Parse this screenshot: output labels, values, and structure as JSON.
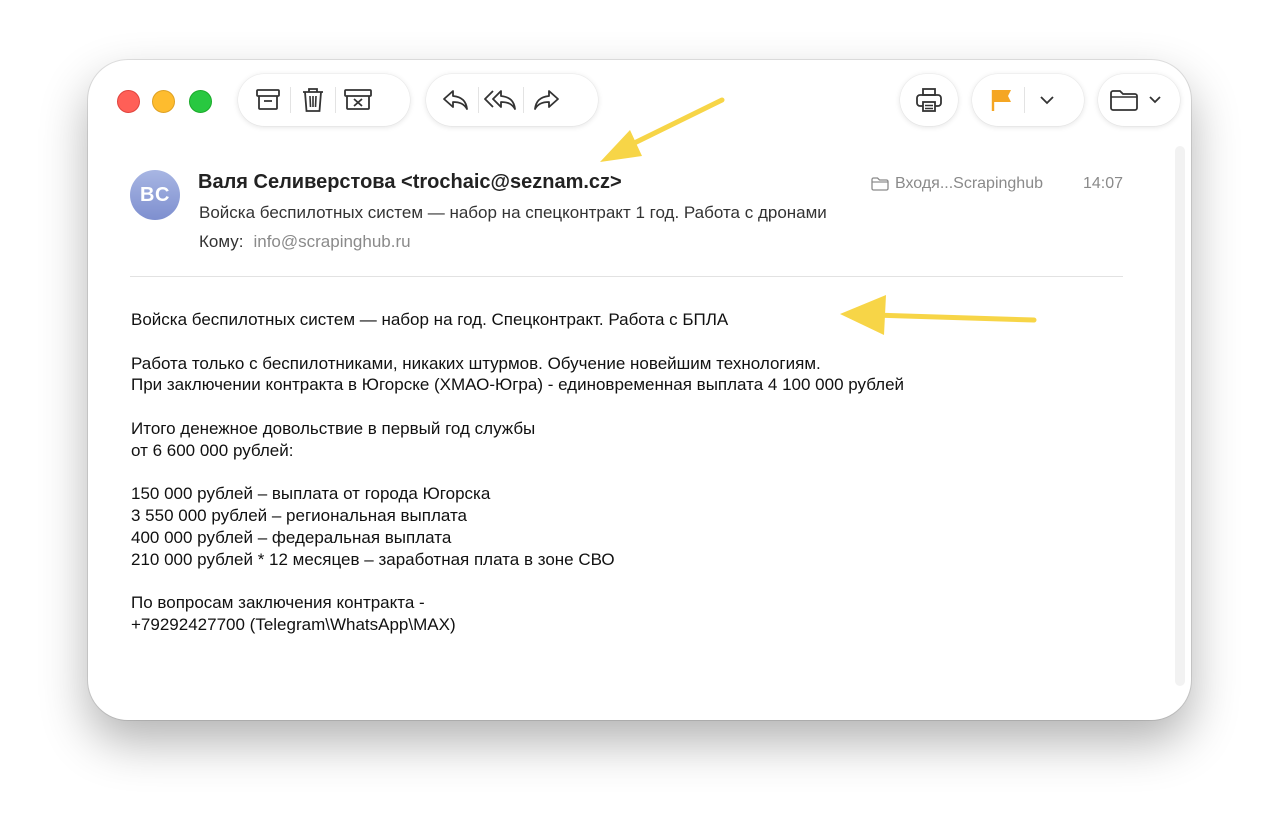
{
  "toolbar": {
    "groups": [
      {
        "items": [
          "archive-icon",
          "trash-icon",
          "junk-icon"
        ]
      },
      {
        "items": [
          "reply-icon",
          "reply-all-icon",
          "forward-icon"
        ]
      },
      {
        "items": [
          "print-icon"
        ]
      },
      {
        "items": [
          "flag-icon",
          "chevron-down-icon"
        ]
      },
      {
        "items": [
          "folder-icon",
          "chevron-down-icon"
        ]
      }
    ],
    "flag_color": "#f5a623"
  },
  "email": {
    "avatar_initials": "BC",
    "from": "Валя Селиверстова <trochaic@seznam.cz>",
    "subject": "Войска беспилотных систем — набор на спецконтракт 1 год. Работа с дронами",
    "to_label": "Кому:",
    "to_address": "info@scrapinghub.ru",
    "mailbox": "Входя...Scrapinghub",
    "time": "14:07",
    "body": {
      "p1": "Войска беспилотных систем — набор на год. Спецконтракт. Работа с БПЛА",
      "p2_l1": "Работа только с беспилотниками, никаких штурмов. Обучение новейшим технологиям.",
      "p2_l2": "При заключении контракта в Югорске (ХМАО-Югра) - единовременная выплата 4 100 000 рублей",
      "p3_l1": "Итого денежное довольствие в первый год службы",
      "p3_l2": "от 6 600 000 рублей:",
      "p4_l1": "150 000 рублей – выплата от города Югорска",
      "p4_l2": "3 550 000 рублей – региональная выплата",
      "p4_l3": "400 000 рублей – федеральная выплата",
      "p4_l4": "210 000 рублей * 12 месяцев – заработная плата в зоне СВО",
      "p5_l1": "По вопросам заключения контракта -",
      "p5_l2": "+79292427700 (Telegram\\WhatsApp\\MAX)"
    }
  },
  "colors": {
    "accent_arrow": "#f7d547"
  }
}
